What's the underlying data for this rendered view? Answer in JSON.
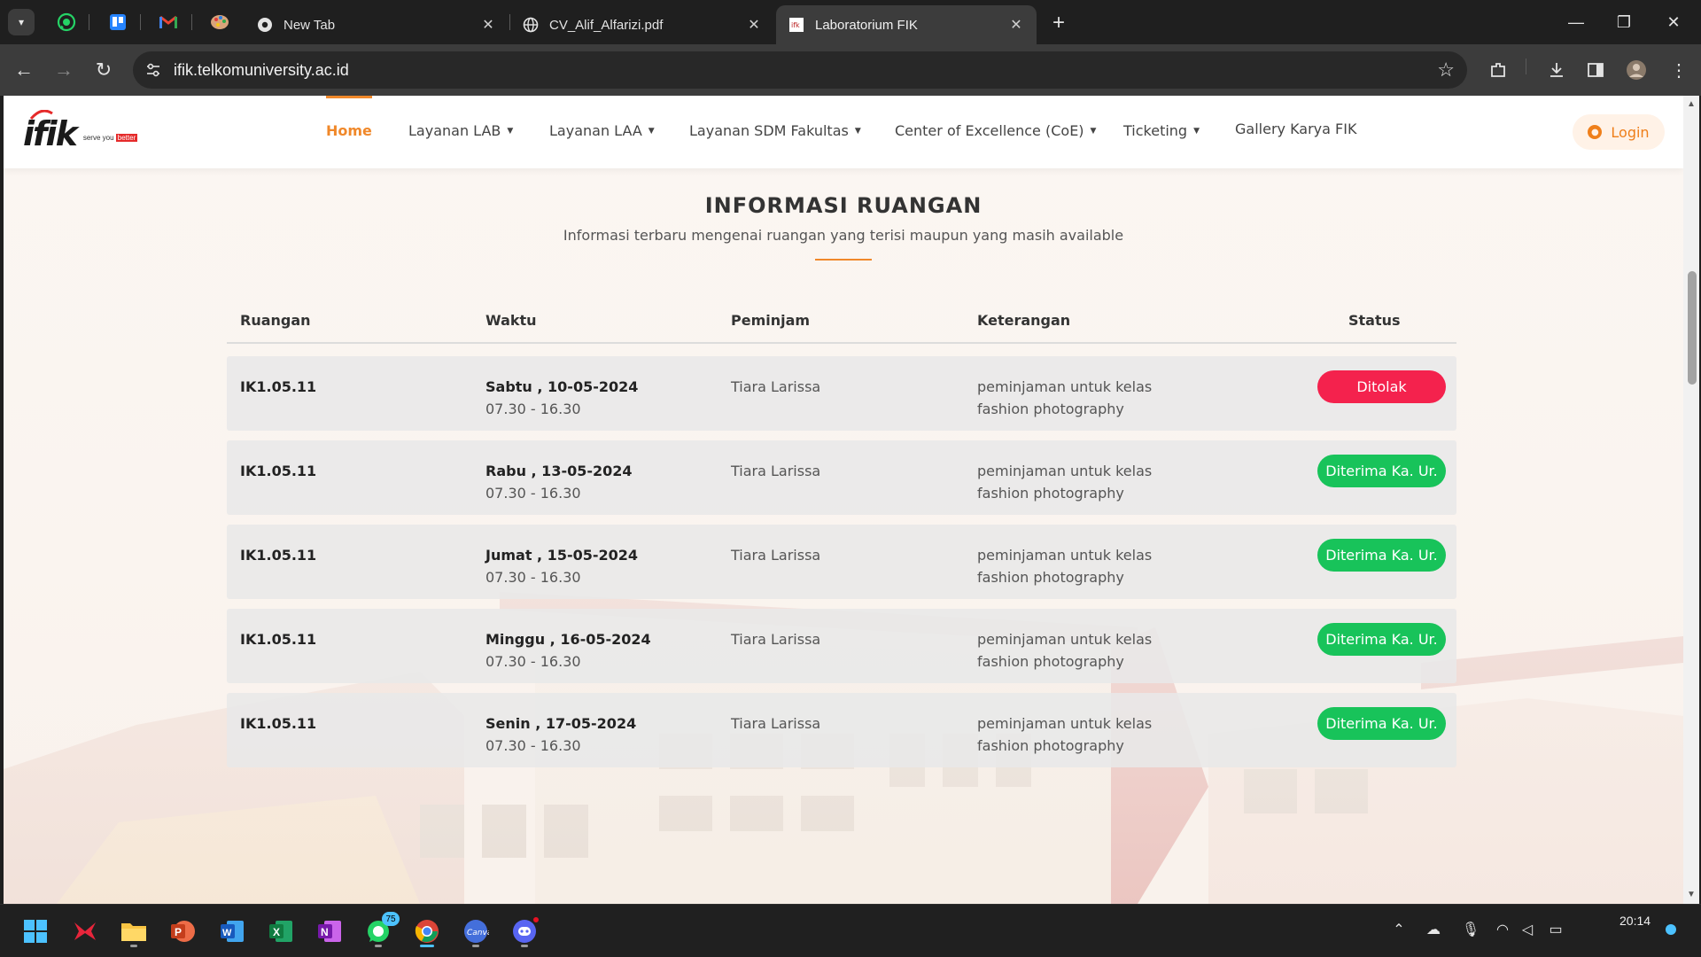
{
  "browser": {
    "tabs": [
      {
        "label": "New Tab",
        "active": false
      },
      {
        "label": "CV_Alif_Alfarizi.pdf",
        "active": false
      },
      {
        "label": "Laboratorium FIK",
        "active": true
      }
    ],
    "pinned": [
      "whatsapp-icon",
      "trello-icon",
      "gmail-icon",
      "palette-icon"
    ],
    "url": "ifik.telkomuniversity.ac.id"
  },
  "site": {
    "logo_text": "ifik",
    "tagline_prefix": "serve you",
    "tagline_highlight": "better",
    "nav": [
      {
        "label": "Home",
        "active": true,
        "dropdown": false
      },
      {
        "label": "Layanan LAB",
        "active": false,
        "dropdown": true
      },
      {
        "label": "Layanan LAA",
        "active": false,
        "dropdown": true
      },
      {
        "label": "Layanan SDM Fakultas",
        "active": false,
        "dropdown": true
      },
      {
        "label": "Center of Excellence (CoE)",
        "active": false,
        "dropdown": true
      },
      {
        "label": "Ticketing",
        "active": false,
        "dropdown": true
      },
      {
        "label": "Gallery Karya FIK",
        "active": false,
        "dropdown": false
      }
    ],
    "login_label": "Login"
  },
  "section": {
    "title": "INFORMASI RUANGAN",
    "subtitle": "Informasi terbaru mengenai ruangan yang terisi maupun yang masih available"
  },
  "table": {
    "headers": [
      "Ruangan",
      "Waktu",
      "Peminjam",
      "Keterangan",
      "Status"
    ],
    "rows": [
      {
        "room": "IK1.05.11",
        "day": "Sabtu , 10-05-2024",
        "time": "07.30 - 16.30",
        "borrower": "Tiara Larissa",
        "note": "peminjaman untuk kelas fashion photography",
        "status": "Ditolak",
        "status_type": "rejected"
      },
      {
        "room": "IK1.05.11",
        "day": "Rabu , 13-05-2024",
        "time": "07.30 - 16.30",
        "borrower": "Tiara Larissa",
        "note": "peminjaman untuk kelas fashion photography",
        "status": "Diterima Ka. Ur.",
        "status_type": "accepted"
      },
      {
        "room": "IK1.05.11",
        "day": "Jumat , 15-05-2024",
        "time": "07.30 - 16.30",
        "borrower": "Tiara Larissa",
        "note": "peminjaman untuk kelas fashion photography",
        "status": "Diterima Ka. Ur.",
        "status_type": "accepted"
      },
      {
        "room": "IK1.05.11",
        "day": "Minggu , 16-05-2024",
        "time": "07.30 - 16.30",
        "borrower": "Tiara Larissa",
        "note": "peminjaman untuk kelas fashion photography",
        "status": "Diterima Ka. Ur.",
        "status_type": "accepted"
      },
      {
        "room": "IK1.05.11",
        "day": "Senin , 17-05-2024",
        "time": "07.30 - 16.30",
        "borrower": "Tiara Larissa",
        "note": "peminjaman untuk kelas fashion photography",
        "status": "Diterima Ka. Ur.",
        "status_type": "accepted"
      }
    ]
  },
  "taskbar": {
    "whatsapp_badge": "75",
    "clock": "20:14"
  },
  "colors": {
    "accent": "#f0882a",
    "rejected": "#f4224d",
    "accepted": "#18c35a"
  }
}
